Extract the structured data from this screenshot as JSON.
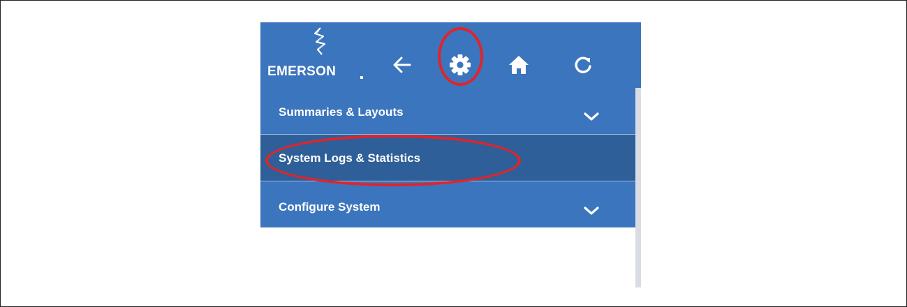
{
  "header": {
    "logo_text": "EMERSON",
    "icons": [
      "back-arrow-icon",
      "gear-icon",
      "home-icon",
      "refresh-icon"
    ]
  },
  "menu": {
    "items": [
      {
        "label": "Summaries & Layouts",
        "expandable": true,
        "active": false
      },
      {
        "label": "System Logs & Statistics",
        "expandable": false,
        "active": true
      },
      {
        "label": "Configure System",
        "expandable": true,
        "active": false
      }
    ]
  },
  "colors": {
    "header_blue": "#3b75bd",
    "active_item_blue": "#2f5f98",
    "highlight_red": "#e0242b"
  }
}
